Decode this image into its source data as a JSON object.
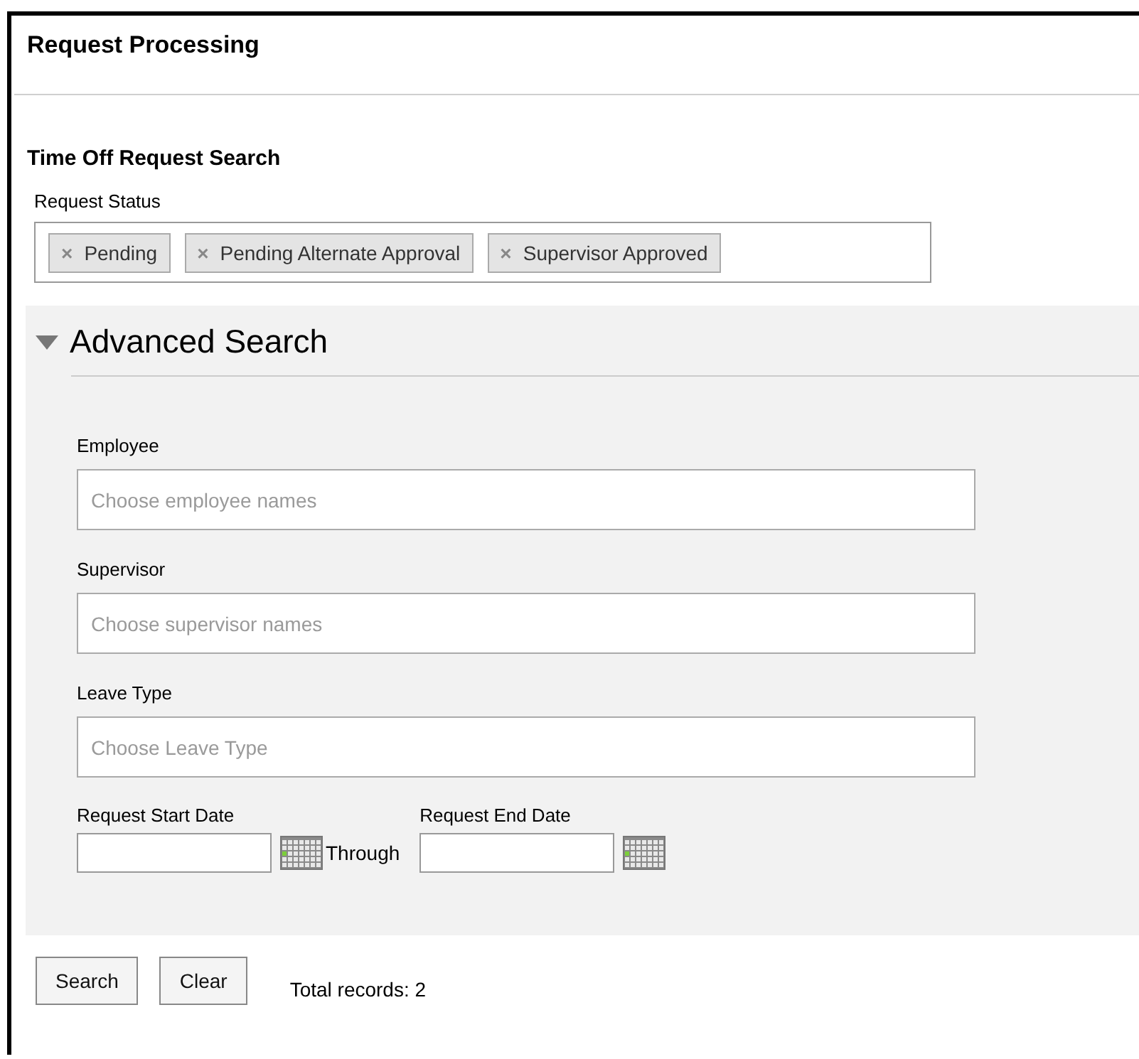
{
  "page": {
    "title": "Request Processing"
  },
  "search": {
    "title": "Time Off Request Search",
    "request_status": {
      "label": "Request Status",
      "tags": [
        {
          "label": "Pending",
          "remove": "×"
        },
        {
          "label": "Pending Alternate Approval",
          "remove": "×"
        },
        {
          "label": "Supervisor Approved",
          "remove": "×"
        }
      ]
    }
  },
  "advanced_search": {
    "title": "Advanced Search",
    "expanded": true,
    "fields": [
      {
        "label": "Employee",
        "placeholder": "Choose employee names"
      },
      {
        "label": "Supervisor",
        "placeholder": "Choose supervisor names"
      },
      {
        "label": "Leave Type",
        "placeholder": "Choose Leave Type"
      }
    ],
    "start_date": {
      "label": "Request Start Date"
    },
    "through": "Through",
    "end_date": {
      "label": "Request End Date"
    }
  },
  "buttons": [
    "Search",
    "Clear"
  ],
  "total_records": "Total records: 2"
}
